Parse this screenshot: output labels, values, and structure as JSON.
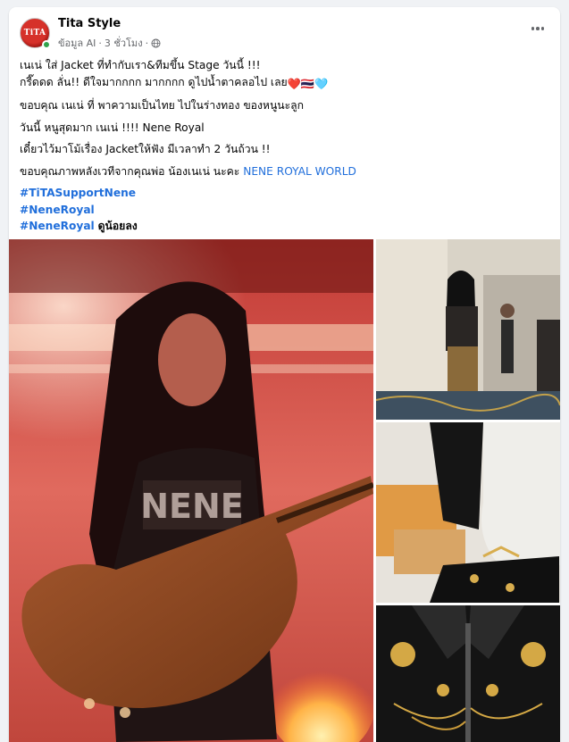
{
  "post": {
    "page_name": "Tita Style",
    "avatar_text": "TiTA",
    "meta_label": "ข้อมูล AI",
    "meta_separator": "·",
    "timestamp": "3 ชั่วโมง",
    "meta_separator_2": "·",
    "icons": {
      "avatar": "page-avatar",
      "privacy": "globe-icon",
      "more": "more-options-icon"
    },
    "lines": [
      "เนเน่ ใส่ Jacket ที่ทำกับเรา&ทีมขึ้น Stage วันนี้  !!!",
      "กรี๊ดดด ลั่น!! ดีใจมากกกก มากกกก ดูไปน้ำตาคลอไป เลย",
      "ขอบคุณ เนเน่ ที่ พาความเป็นไทย ไปในร่างทอง ของหนูนะลูก",
      "วันนี้ หนูสุดมาก เนเน่ !!!!  Nene Royal",
      "เดี๋ยวไว้มาโม้เรื่อง Jacketให้ฟัง มีเวลาทำ 2 วันถ้วน !!",
      "ขอบคุณภาพหลังเวทีจากคุณพ่อ น้องเนเน่ นะคะ "
    ],
    "emoji_line2": "❤️🇹🇭🩵",
    "link_text": "NENE ROYAL WORLD",
    "hashtags": [
      "#TiTASupportNene",
      "#NeneRoyal",
      "#NeneRoyal"
    ],
    "see_less": "ดูน้อยลง",
    "colors": {
      "link": "#216fdb",
      "meta": "#65676b",
      "online": "#31a24c"
    }
  }
}
